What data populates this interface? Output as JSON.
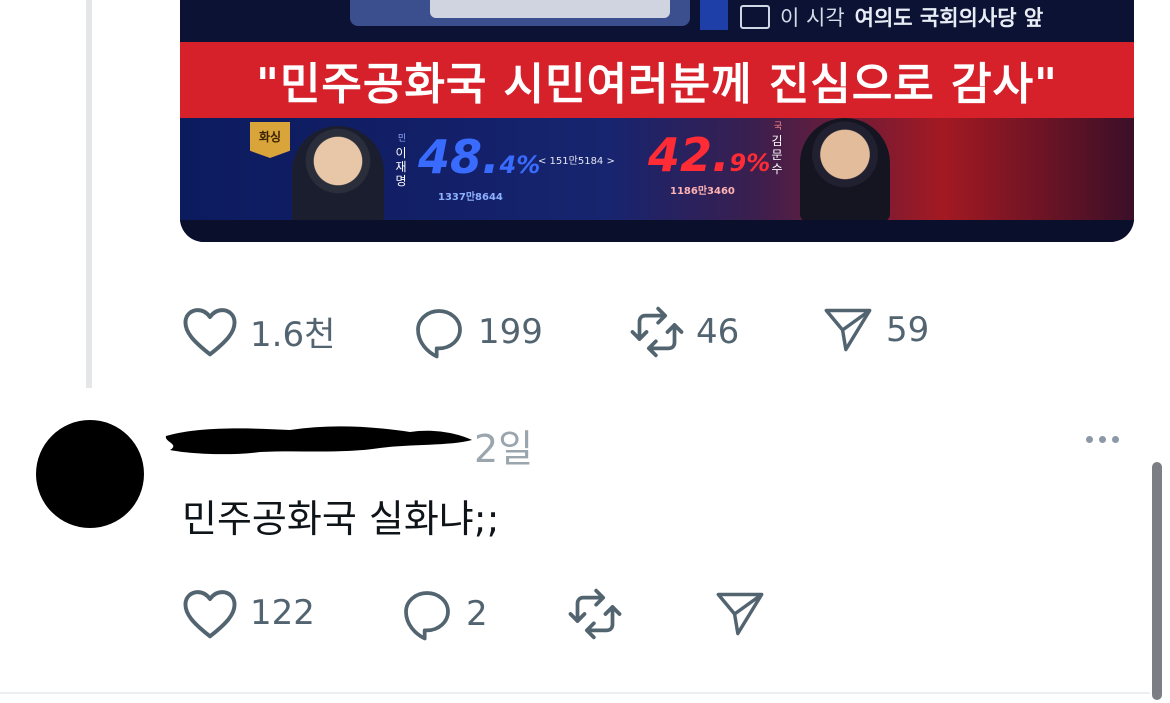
{
  "post": {
    "media": {
      "location_prefix": "이 시각",
      "location": "여의도 국회의사당 앞",
      "banner": "\"민주공화국 시민여러분께 진심으로 감사\"",
      "badge": "화싱",
      "candidate1": {
        "party_glyph": "민",
        "name_vertical": "이재명",
        "pct_int": "48.",
        "pct_dec": "4%",
        "votes": "1337만8644",
        "color": "#3a6bff"
      },
      "candidate2": {
        "party_glyph": "국",
        "name_vertical": "김문수",
        "pct_int": "42.",
        "pct_dec": "9%",
        "votes": "1186만3460",
        "color": "#ff2b35"
      },
      "gap": "< 151만5184 >"
    },
    "actions": {
      "likes": "1.6천",
      "replies": "199",
      "reposts": "46",
      "shares": "59"
    }
  },
  "reply": {
    "time": "2일",
    "text": "민주공화국 실화냐;;",
    "actions": {
      "likes": "122",
      "replies": "2"
    }
  },
  "colors": {
    "icon": "#536471",
    "banner_red": "#d6202a",
    "timestamp": "#9ba5ae"
  }
}
